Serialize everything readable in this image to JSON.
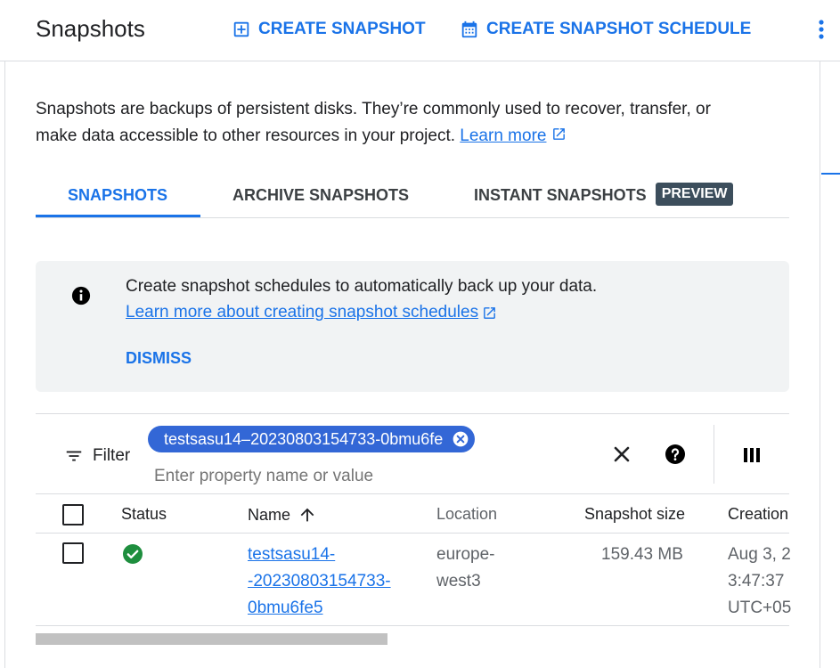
{
  "header": {
    "title": "Snapshots",
    "create_snapshot": "CREATE SNAPSHOT",
    "create_schedule": "CREATE SNAPSHOT SCHEDULE"
  },
  "description": {
    "text": "Snapshots are backups of persistent disks. They’re commonly used to recover, transfer, or make data accessible to other resources in your project.",
    "learn_more": "Learn more"
  },
  "tabs": [
    {
      "label": "SNAPSHOTS",
      "active": true
    },
    {
      "label": "ARCHIVE SNAPSHOTS",
      "active": false
    },
    {
      "label": "INSTANT SNAPSHOTS",
      "active": false,
      "badge": "PREVIEW"
    }
  ],
  "banner": {
    "text": "Create snapshot schedules to automatically back up your data.",
    "link": "Learn more about creating snapshot schedules",
    "dismiss": "DISMISS"
  },
  "filter": {
    "label": "Filter",
    "chip": "testsasu14–20230803154733-0bmu6fe",
    "placeholder": "Enter property name or value"
  },
  "table": {
    "columns": [
      "Status",
      "Name",
      "Location",
      "Snapshot size",
      "Creation"
    ],
    "sort_column": "Name",
    "rows": [
      {
        "status": "ok",
        "name_lines": [
          "testsasu14-",
          "-20230803154733-",
          "0bmu6fe5"
        ],
        "location_lines": [
          "europe-",
          "west3"
        ],
        "size": "159.43 MB",
        "creation_lines": [
          "Aug 3, 2",
          "3:47:37",
          "UTC+05"
        ]
      }
    ]
  },
  "colors": {
    "accent": "#1a73e8",
    "chip": "#3367d6",
    "badge": "#3c4e5c",
    "status_ok": "#1e8e3e"
  }
}
